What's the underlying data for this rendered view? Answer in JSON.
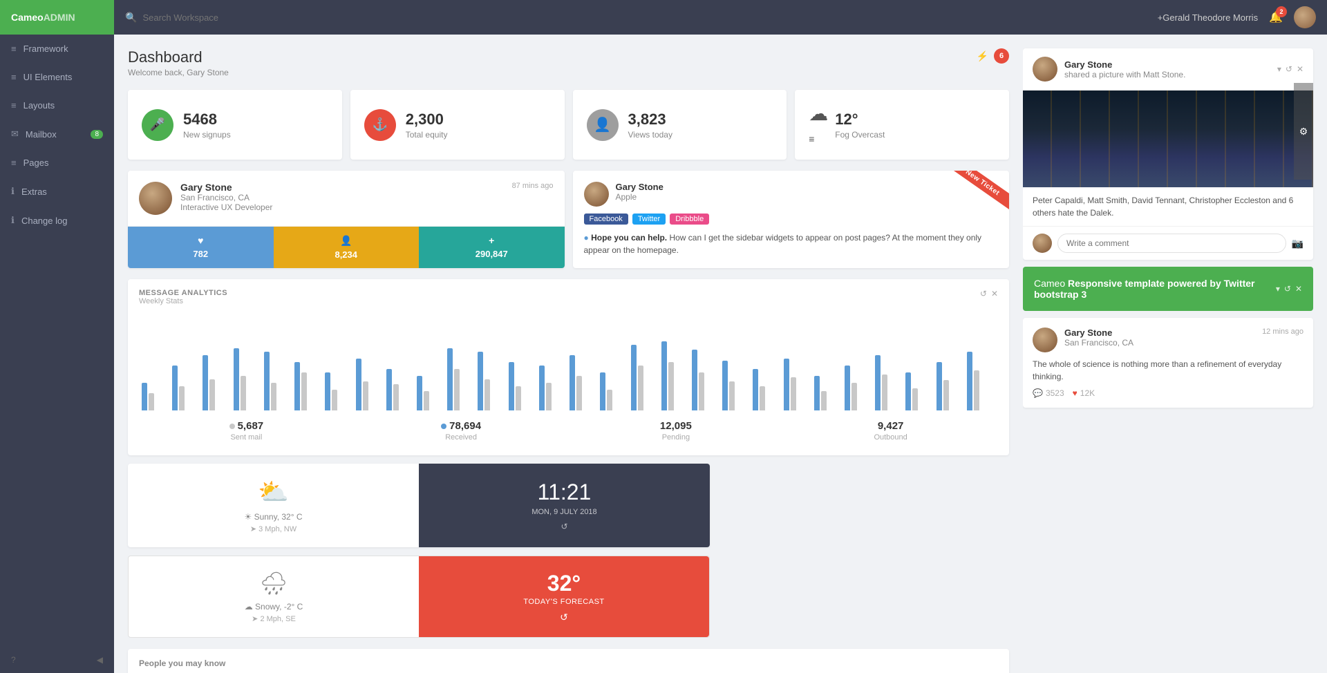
{
  "brand": {
    "prefix": "Cameo",
    "suffix": "ADMIN"
  },
  "topnav": {
    "search_placeholder": "Search Workspace",
    "user_name": "+Gerald Theodore Morris",
    "notif_count": "2"
  },
  "sidebar": {
    "items": [
      {
        "id": "framework",
        "label": "Framework",
        "icon": "☰",
        "badge": null
      },
      {
        "id": "ui-elements",
        "label": "UI Elements",
        "icon": "☰",
        "badge": null
      },
      {
        "id": "layouts",
        "label": "Layouts",
        "icon": "☰",
        "badge": null
      },
      {
        "id": "mailbox",
        "label": "Mailbox",
        "icon": "✉",
        "badge": "8"
      },
      {
        "id": "pages",
        "label": "Pages",
        "icon": "☰",
        "badge": null
      },
      {
        "id": "extras",
        "label": "Extras",
        "icon": "ℹ",
        "badge": null
      },
      {
        "id": "change-log",
        "label": "Change log",
        "icon": "ℹ",
        "badge": null
      }
    ],
    "collapse_label": "◀",
    "help_label": "?"
  },
  "page": {
    "title": "Dashboard",
    "subtitle": "Welcome back, Gary Stone",
    "action_badge": "6"
  },
  "stats": [
    {
      "id": "signups",
      "icon": "🎤",
      "icon_color": "green",
      "value": "5468",
      "label": "New signups"
    },
    {
      "id": "equity",
      "icon": "⚓",
      "icon_color": "red",
      "value": "2,300",
      "label": "Total equity"
    },
    {
      "id": "views",
      "icon": "👤",
      "icon_color": "gray",
      "value": "3,823",
      "label": "Views today"
    },
    {
      "id": "weather",
      "icon": "☁",
      "icon_color": "weather",
      "value": "12°",
      "label": "Fog Overcast"
    }
  ],
  "profile_card": {
    "name": "Gary Stone",
    "location": "San Francisco, CA",
    "role": "Interactive UX Developer",
    "time_ago": "87 mins ago",
    "stats": [
      {
        "label": "782",
        "icon": "♥",
        "color": "blue"
      },
      {
        "label": "8,234",
        "icon": "👤",
        "color": "orange"
      },
      {
        "label": "290,847",
        "icon": "+",
        "color": "teal"
      }
    ]
  },
  "ticket": {
    "name": "Gary Stone",
    "company": "Apple",
    "ribbon": "New Ticket",
    "tags": [
      "Facebook",
      "Twitter",
      "Dribbble"
    ],
    "tag_colors": [
      "fb",
      "tw",
      "dr"
    ],
    "body_highlight": "Hope you can help.",
    "body_text": " How can I get the sidebar widgets to appear on post pages? At the moment they only appear on the homepage."
  },
  "social_post": {
    "name": "Gary Stone",
    "action": "shared a picture with Matt Stone.",
    "caption": "Peter Capaldi, Matt Smith, David Tennant, Christopher Eccleston and 6 others hate the Dalek.",
    "comment_placeholder": "Write a comment",
    "controls": [
      "▾",
      "↺",
      "✕"
    ]
  },
  "analytics": {
    "title": "MESSAGE ANALYTICS",
    "subtitle": "Weekly Stats",
    "stats": [
      {
        "value": "5,687",
        "label": "Sent mail",
        "dot_color": "#c8c8c8"
      },
      {
        "value": "78,694",
        "label": "Received",
        "dot_color": "#5b9bd5"
      },
      {
        "value": "12,095",
        "label": "Pending",
        "dot_color": ""
      },
      {
        "value": "9,427",
        "label": "Outbound",
        "dot_color": ""
      }
    ],
    "bars": [
      [
        40,
        25
      ],
      [
        65,
        35
      ],
      [
        80,
        45
      ],
      [
        90,
        50
      ],
      [
        85,
        40
      ],
      [
        70,
        55
      ],
      [
        55,
        30
      ],
      [
        75,
        42
      ],
      [
        60,
        38
      ],
      [
        50,
        28
      ],
      [
        90,
        60
      ],
      [
        85,
        45
      ],
      [
        70,
        35
      ],
      [
        65,
        40
      ],
      [
        80,
        50
      ],
      [
        55,
        30
      ],
      [
        95,
        65
      ],
      [
        100,
        70
      ],
      [
        88,
        55
      ],
      [
        72,
        42
      ],
      [
        60,
        35
      ],
      [
        75,
        48
      ],
      [
        50,
        28
      ],
      [
        65,
        40
      ],
      [
        80,
        52
      ],
      [
        55,
        32
      ],
      [
        70,
        44
      ],
      [
        85,
        58
      ]
    ]
  },
  "weather_widget": {
    "sunny_icon": "⛅",
    "sunny_desc": "Sunny, 32° C",
    "sunny_wind": "3 Mph, NW",
    "time": "11:21",
    "date": "MON, 9 JULY 2018",
    "snowy_icon": "🌧",
    "snowy_desc": "Snowy, -2° C",
    "snowy_wind": "2 Mph, SE",
    "temp": "32°",
    "forecast": "TODAY'S FORECAST"
  },
  "promo_card": {
    "text_normal": "Cameo ",
    "text_bold": "Responsive template powered by Twitter bootstrap 3",
    "controls": [
      "▾",
      "↺",
      "✕"
    ]
  },
  "post_card": {
    "name": "Gary Stone",
    "location": "San Francisco, CA",
    "time_ago": "12 mins ago",
    "body": "The whole of science is nothing more than a refinement of everyday thinking.",
    "comments": "3523",
    "likes": "12K"
  },
  "people_section": {
    "title": "People you may know"
  }
}
